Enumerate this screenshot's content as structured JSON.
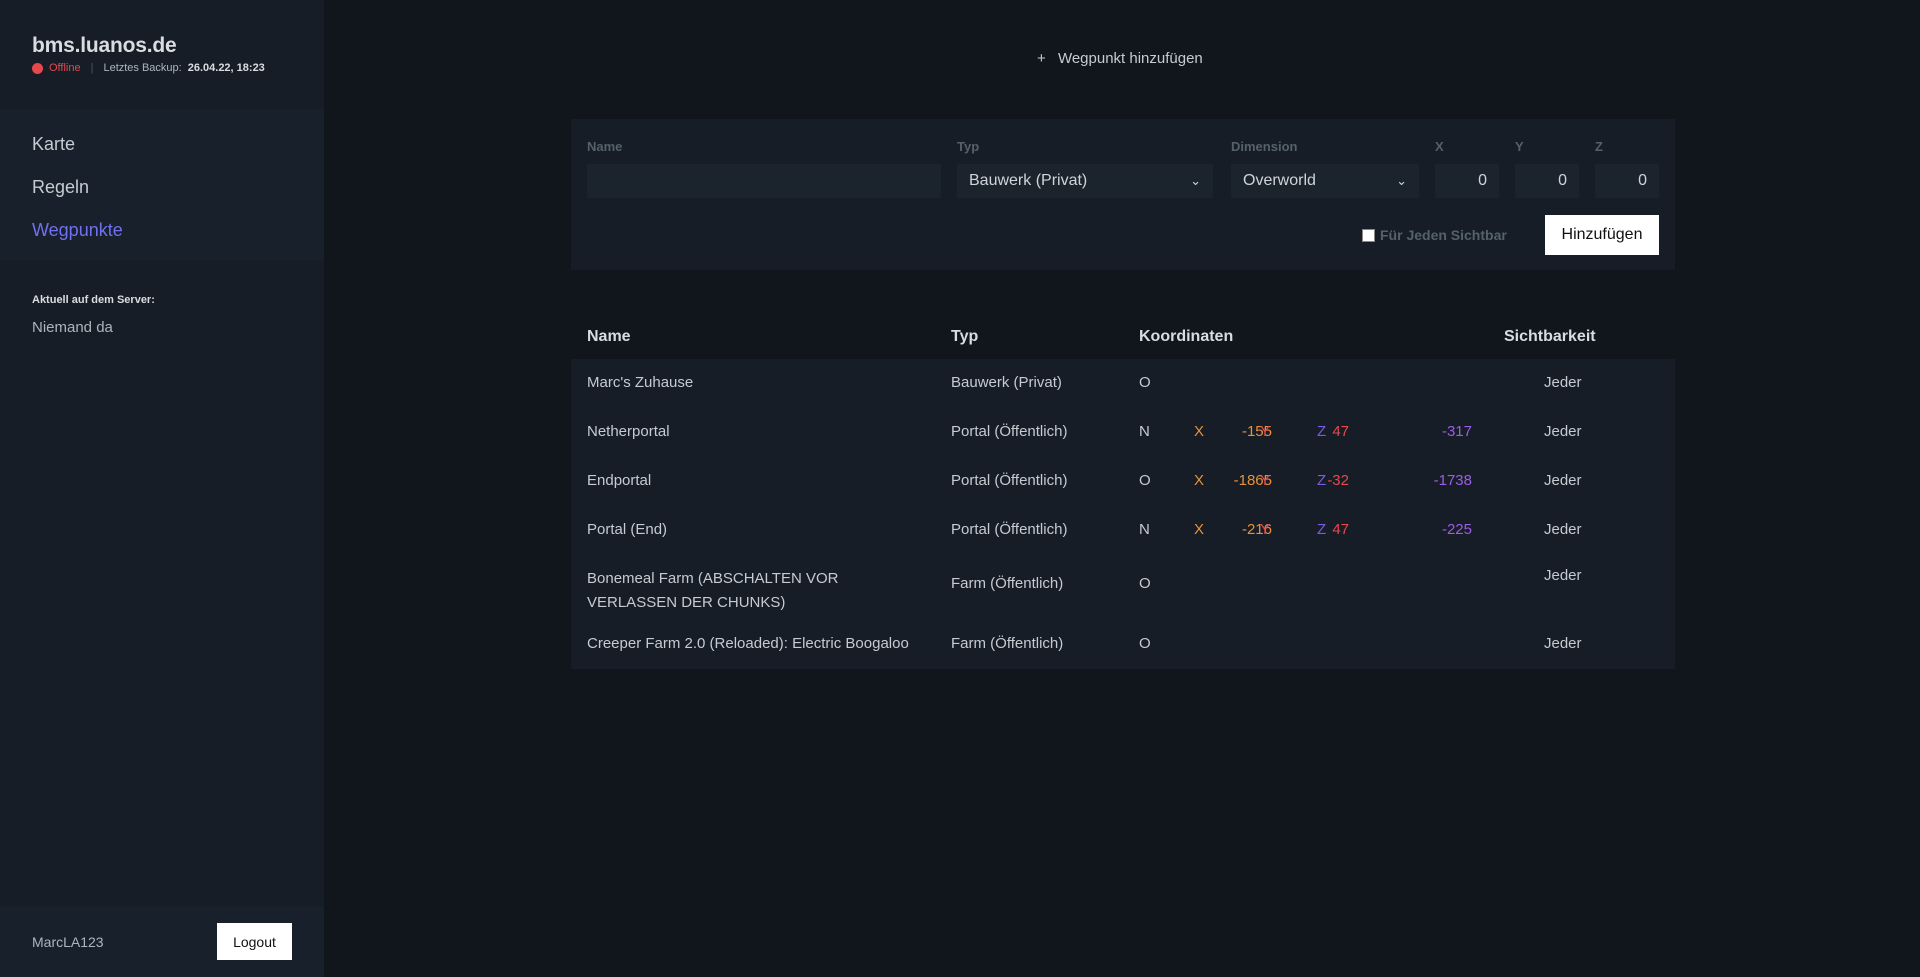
{
  "sidebar": {
    "title": "bms.luanos.de",
    "status": "Offline",
    "backup_label": "Letztes Backup:",
    "backup_value": "26.04.22, 18:23",
    "nav": [
      {
        "label": "Karte"
      },
      {
        "label": "Regeln"
      },
      {
        "label": "Wegpunkte"
      }
    ],
    "online_title": "Aktuell auf dem Server:",
    "online_value": "Niemand da",
    "username": "MarcLA123",
    "logout_label": "Logout"
  },
  "main": {
    "add_toggle": "Wegpunkt hinzufügen",
    "form": {
      "name_label": "Name",
      "name_value": "",
      "type_label": "Typ",
      "type_value": "Bauwerk (Privat)",
      "dimension_label": "Dimension",
      "dimension_value": "Overworld",
      "x_label": "X",
      "x_value": "0",
      "y_label": "Y",
      "y_value": "0",
      "z_label": "Z",
      "z_value": "0",
      "public_label": "Für Jeden Sichtbar",
      "submit_label": "Hinzufügen"
    },
    "table": {
      "headers": {
        "name": "Name",
        "type": "Typ",
        "coords": "Koordinaten",
        "visibility": "Sichtbarkeit"
      },
      "rows": [
        {
          "name": "Marc's Zuhause",
          "type": "Bauwerk (Privat)",
          "dim": "O",
          "x": "",
          "y": "",
          "z": "",
          "visibility": "Jeder"
        },
        {
          "name": "Netherportal",
          "type": "Portal (Öffentlich)",
          "dim": "N",
          "x": "-155",
          "y": "47",
          "z": "-317",
          "visibility": "Jeder"
        },
        {
          "name": "Endportal",
          "type": "Portal (Öffentlich)",
          "dim": "O",
          "x": "-1865",
          "y": "-32",
          "z": "-1738",
          "visibility": "Jeder"
        },
        {
          "name": "Portal (End)",
          "type": "Portal (Öffentlich)",
          "dim": "N",
          "x": "-216",
          "y": "47",
          "z": "-225",
          "visibility": "Jeder"
        },
        {
          "name": "Bonemeal Farm (ABSCHALTEN VOR VERLASSEN DER CHUNKS)",
          "type": "Farm (Öffentlich)",
          "dim": "O",
          "x": "",
          "y": "",
          "z": "",
          "visibility": "Jeder"
        },
        {
          "name": "Creeper Farm 2.0 (Reloaded): Electric Boogaloo",
          "type": "Farm (Öffentlich)",
          "dim": "O",
          "x": "",
          "y": "",
          "z": "",
          "visibility": "Jeder"
        }
      ],
      "coord_labels": {
        "x": "X",
        "y": "Y",
        "z": "Z"
      }
    }
  },
  "colors": {
    "background": "#11161d",
    "sidebar": "#161d26",
    "accent": "#7170f0",
    "offline": "#e5484d",
    "coord_x": "#e8913a",
    "coord_y": "#e5484d",
    "coord_z": "#9b5de5"
  }
}
